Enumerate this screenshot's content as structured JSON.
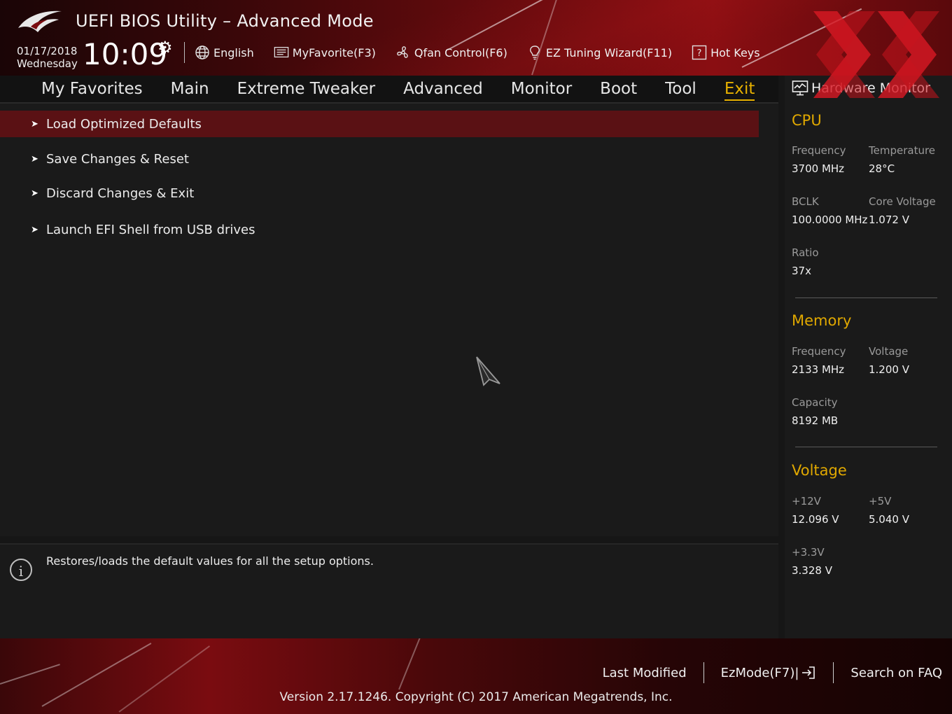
{
  "header": {
    "title": "UEFI BIOS Utility – Advanced Mode",
    "date": "01/17/2018",
    "weekday": "Wednesday",
    "time": "10:09",
    "toolbar": [
      {
        "label": "English",
        "icon": "globe-icon"
      },
      {
        "label": "MyFavorite(F3)",
        "icon": "favorite-list-icon"
      },
      {
        "label": "Qfan Control(F6)",
        "icon": "fan-icon"
      },
      {
        "label": "EZ Tuning Wizard(F11)",
        "icon": "lightbulb-icon"
      },
      {
        "label": "Hot Keys",
        "icon": "question-box-icon"
      }
    ]
  },
  "nav": {
    "tabs": [
      "My Favorites",
      "Main",
      "Extreme Tweaker",
      "Advanced",
      "Monitor",
      "Boot",
      "Tool",
      "Exit"
    ],
    "active": "Exit"
  },
  "menu": {
    "items": [
      "Load Optimized Defaults",
      "Save Changes & Reset",
      "Discard Changes & Exit",
      "Launch EFI Shell from USB drives"
    ],
    "selected_index": 0
  },
  "help": {
    "text": "Restores/loads the default values for all the setup options."
  },
  "hardware_monitor": {
    "title": "Hardware Monitor",
    "cpu": {
      "title": "CPU",
      "frequency_label": "Frequency",
      "frequency": "3700 MHz",
      "temperature_label": "Temperature",
      "temperature": "28°C",
      "bclk_label": "BCLK",
      "bclk": "100.0000 MHz",
      "core_voltage_label": "Core Voltage",
      "core_voltage": "1.072 V",
      "ratio_label": "Ratio",
      "ratio": "37x"
    },
    "memory": {
      "title": "Memory",
      "frequency_label": "Frequency",
      "frequency": "2133 MHz",
      "voltage_label": "Voltage",
      "voltage": "1.200 V",
      "capacity_label": "Capacity",
      "capacity": "8192 MB"
    },
    "voltage": {
      "title": "Voltage",
      "v12_label": "+12V",
      "v12": "12.096 V",
      "v5_label": "+5V",
      "v5": "5.040 V",
      "v33_label": "+3.3V",
      "v33": "3.328 V"
    }
  },
  "footer": {
    "last_modified": "Last Modified",
    "ezmode": "EzMode(F7)|",
    "search_faq": "Search on FAQ",
    "version": "Version 2.17.1246. Copyright (C) 2017 American Megatrends, Inc."
  },
  "colors": {
    "accent": "#e0a800",
    "selected_row": "#5a1114",
    "brand_red": "#8a0e12",
    "panel_bg": "#1a1a1a"
  }
}
